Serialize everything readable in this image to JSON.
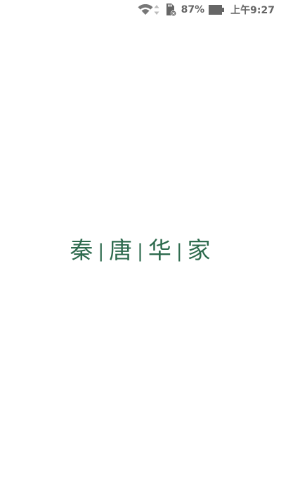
{
  "status_bar": {
    "battery_percent": "87%",
    "time": "上午9:27",
    "icons": [
      "wifi-icon",
      "data-arrows-icon",
      "sd-card-alert-icon",
      "battery-icon"
    ]
  },
  "splash": {
    "chars": [
      "秦",
      "唐",
      "华",
      "家"
    ],
    "separator": "|",
    "color": "#2e6b4e"
  }
}
